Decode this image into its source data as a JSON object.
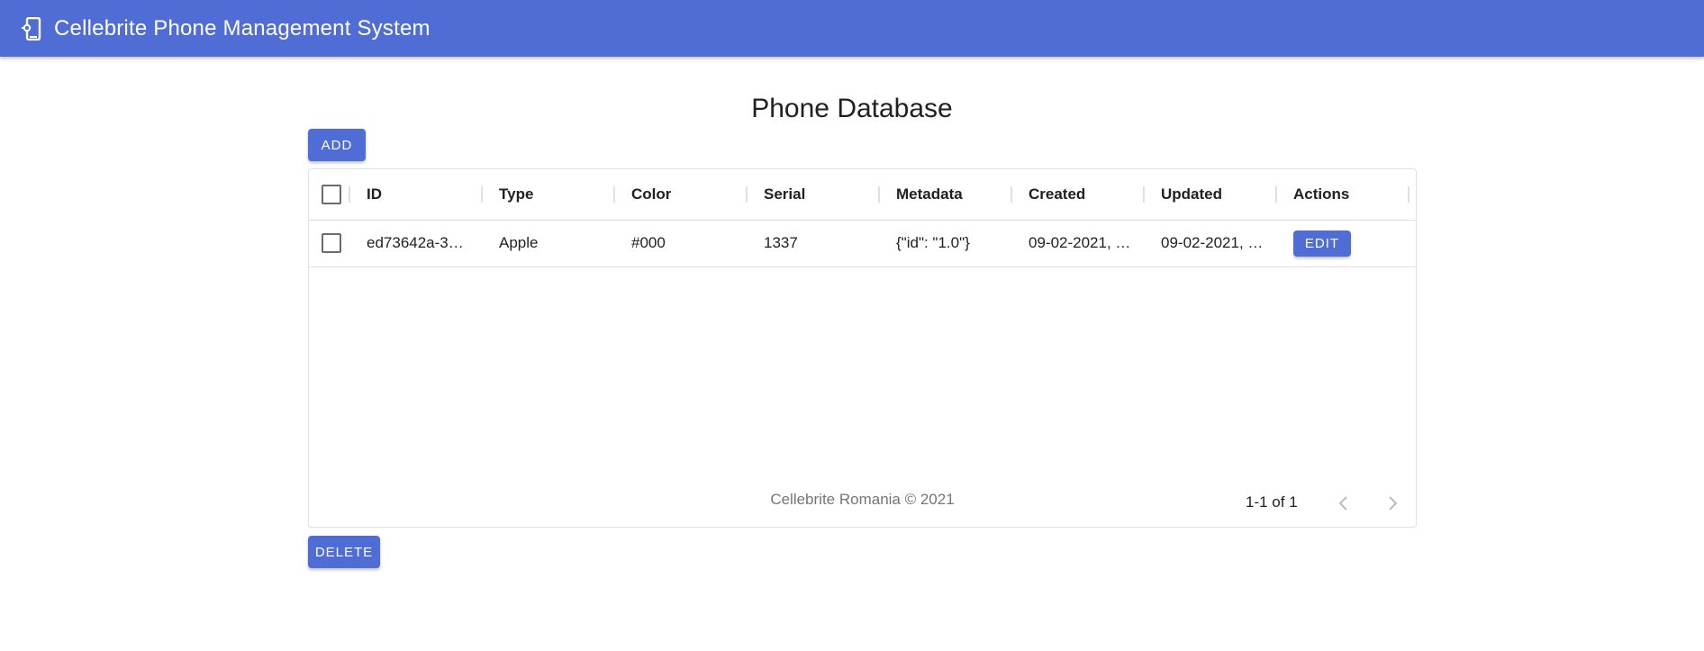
{
  "app": {
    "title": "Cellebrite Phone Management System",
    "icon": "phone-settings-icon",
    "color": "#4f6dd5"
  },
  "page": {
    "title": "Phone Database"
  },
  "toolbar": {
    "add_label": "ADD",
    "delete_label": "DELETE"
  },
  "table": {
    "columns": [
      "ID",
      "Type",
      "Color",
      "Serial",
      "Metadata",
      "Created",
      "Updated",
      "Actions"
    ],
    "rows": [
      {
        "id": "ed73642a-3…",
        "type": "Apple",
        "color": "#000",
        "serial": "1337",
        "metadata": "{\"id\": \"1.0\"}",
        "created": "09-02-2021, …",
        "updated": "09-02-2021, …",
        "action_label": "EDIT"
      }
    ],
    "footer": "Cellebrite Romania © 2021",
    "pagination": "1-1 of 1"
  }
}
